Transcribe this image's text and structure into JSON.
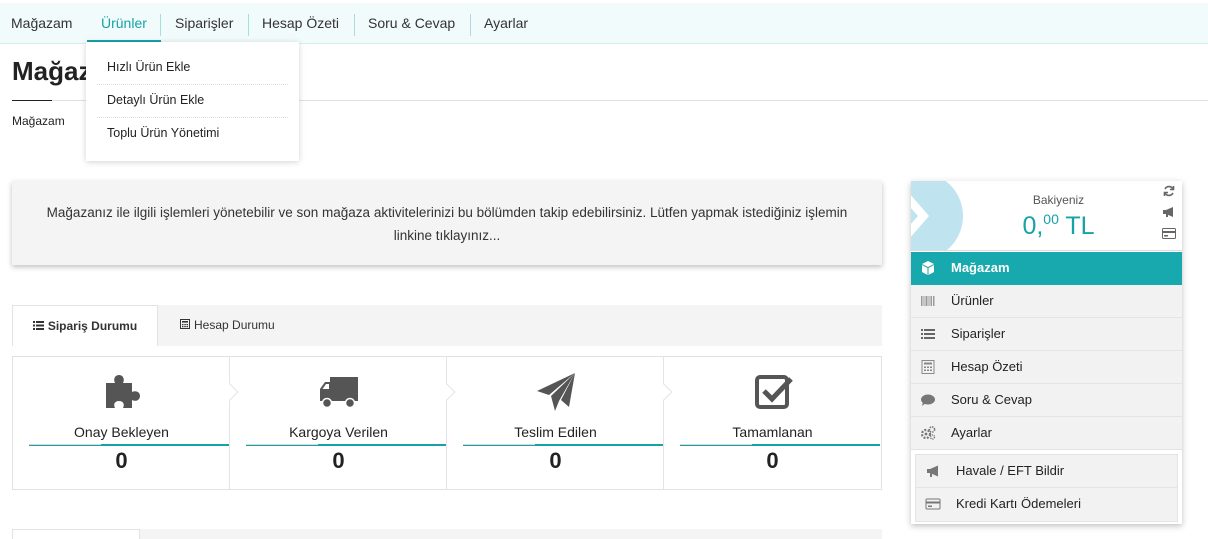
{
  "topnav": {
    "items": [
      "Mağazam",
      "Ürünler",
      "Siparişler",
      "Hesap Özeti",
      "Soru & Cevap",
      "Ayarlar"
    ],
    "active_index": 1
  },
  "dropdown": {
    "items": [
      "Hızlı Ürün Ekle",
      "Detaylı Ürün Ekle",
      "Toplu Ürün Yönetimi"
    ]
  },
  "page": {
    "title": "Mağazam",
    "breadcrumb": "Mağazam"
  },
  "info": {
    "text": "Mağazanız ile ilgili işlemleri yönetebilir ve son mağaza aktivitelerinizi bu bölümden takip edebilirsiniz. Lütfen yapmak istediğiniz işlemin linkine tıklayınız..."
  },
  "tabs": [
    {
      "label": "Sipariş Durumu",
      "icon": "list-icon",
      "active": true
    },
    {
      "label": "Hesap Durumu",
      "icon": "calculator-icon",
      "active": false
    }
  ],
  "status": [
    {
      "label": "Onay Bekleyen",
      "count": "0",
      "icon": "puzzle-icon"
    },
    {
      "label": "Kargoya Verilen",
      "count": "0",
      "icon": "truck-icon"
    },
    {
      "label": "Teslim Edilen",
      "count": "0",
      "icon": "paper-plane-icon"
    },
    {
      "label": "Tamamlanan",
      "count": "0",
      "icon": "check-square-icon"
    }
  ],
  "sidebar": {
    "balance_label": "Bakiyeniz",
    "balance_int": "0,",
    "balance_dec": "00",
    "balance_currency": "TL",
    "menu": [
      {
        "label": "Mağazam",
        "icon": "cube-icon",
        "active": true
      },
      {
        "label": "Ürünler",
        "icon": "barcode-icon"
      },
      {
        "label": "Siparişler",
        "icon": "list-icon"
      },
      {
        "label": "Hesap Özeti",
        "icon": "calculator-icon"
      },
      {
        "label": "Soru & Cevap",
        "icon": "comment-icon"
      },
      {
        "label": "Ayarlar",
        "icon": "cogs-icon"
      }
    ],
    "submenu": [
      {
        "label": "Havale / EFT Bildir",
        "icon": "megaphone-icon"
      },
      {
        "label": "Kredi Kartı Ödemeleri",
        "icon": "credit-card-icon"
      }
    ]
  },
  "colors": {
    "accent": "#17a2a8",
    "accent_sidebar": "#17a9ad"
  }
}
